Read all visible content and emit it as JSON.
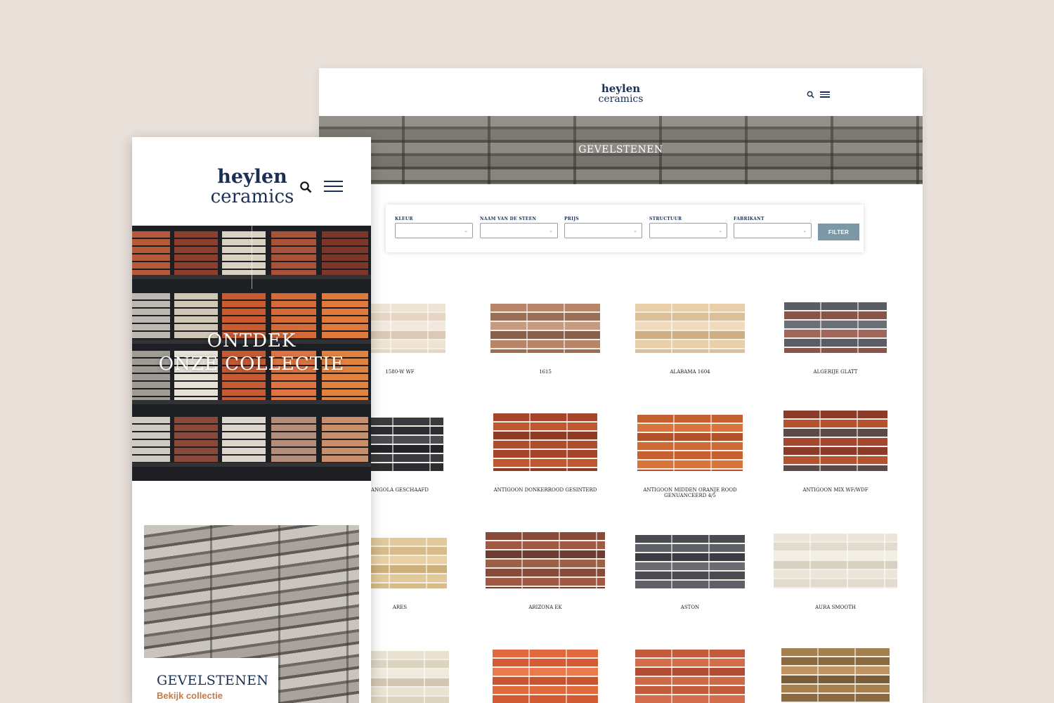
{
  "desktop": {
    "logo": {
      "line1": "heylen",
      "line2": "ceramics"
    },
    "hero_title": "GEVELSTENEN",
    "filters": [
      {
        "label": "KLEUR",
        "value": ""
      },
      {
        "label": "NAAM VAN DE STEEN",
        "value": ""
      },
      {
        "label": "PRIJS",
        "value": ""
      },
      {
        "label": "STRUCTUUR",
        "value": ""
      },
      {
        "label": "FABRIKANT",
        "value": ""
      }
    ],
    "filter_button": "FILTER",
    "products": [
      {
        "name": "1580-W WF",
        "palette": [
          "#efe3d3",
          "#e6d6c3",
          "#f2e8dc",
          "#dcc9b3"
        ]
      },
      {
        "name": "1615",
        "palette": [
          "#b7856a",
          "#9e6d55",
          "#c79b7f",
          "#8c5f4b"
        ]
      },
      {
        "name": "ALABAMA 1604",
        "palette": [
          "#e8cfaa",
          "#dcbf97",
          "#f0dcbd",
          "#cfae84"
        ]
      },
      {
        "name": "ALGERIJE GLATT",
        "palette": [
          "#5a5d64",
          "#8a5548",
          "#6c6f76",
          "#a0675a"
        ]
      },
      {
        "name": "ANGOLA GESCHAAFD",
        "palette": [
          "#3a3b3e",
          "#2c2d30",
          "#4a4b4f",
          "#232427"
        ]
      },
      {
        "name": "ANTIGOON DONKERROOD GESINTERD",
        "palette": [
          "#a6452a",
          "#c0582f",
          "#8f3a24",
          "#b04d2c"
        ]
      },
      {
        "name": "ANTIGOON MIDDEN ORANJE ROOD GENUANCEERD 4/5",
        "palette": [
          "#c6612f",
          "#d8743c",
          "#b25229",
          "#cd6a35"
        ]
      },
      {
        "name": "ANTIGOON MIX WF/WDF",
        "palette": [
          "#8c3a2a",
          "#b5532f",
          "#5b4a4a",
          "#a44630"
        ]
      },
      {
        "name": "ARES",
        "palette": [
          "#e2c99a",
          "#d7bb89",
          "#eacfa2",
          "#cdb07c"
        ]
      },
      {
        "name": "ARIZONA EK",
        "palette": [
          "#8a4a3a",
          "#a05a44",
          "#6e3c30",
          "#9a6048"
        ]
      },
      {
        "name": "ASTON",
        "palette": [
          "#4a4c52",
          "#5e6067",
          "#3b3d42",
          "#6a6c72"
        ]
      },
      {
        "name": "AURA SMOOTH",
        "palette": [
          "#ebe6da",
          "#e0dbcd",
          "#f2eee4",
          "#d7d1c2"
        ]
      },
      {
        "name": "",
        "palette": [
          "#e9e2d2",
          "#ddd4c0",
          "#f0eadc",
          "#d2c8b2"
        ]
      },
      {
        "name": "",
        "palette": [
          "#e06a3e",
          "#d25c33",
          "#ea7a4c",
          "#c8552f"
        ]
      },
      {
        "name": "",
        "palette": [
          "#c25a3c",
          "#d36d4c",
          "#b04c33",
          "#cc6a4a"
        ]
      },
      {
        "name": "",
        "palette": [
          "#a5804f",
          "#8c6a40",
          "#c09460",
          "#7c5d3a"
        ]
      }
    ]
  },
  "mobile": {
    "logo": {
      "line1": "heylen",
      "line2": "ceramics"
    },
    "hero_title": [
      "ONTDEK",
      "ONZE COLLECTIE"
    ],
    "card_title": "GEVELSTENEN",
    "card_link": "Bekijk collectie"
  },
  "colors": {
    "background": "#e8e0d9",
    "brand_navy": "#1b2f55",
    "accent_orange": "#c57b47",
    "filter_button": "#7c98a6"
  }
}
